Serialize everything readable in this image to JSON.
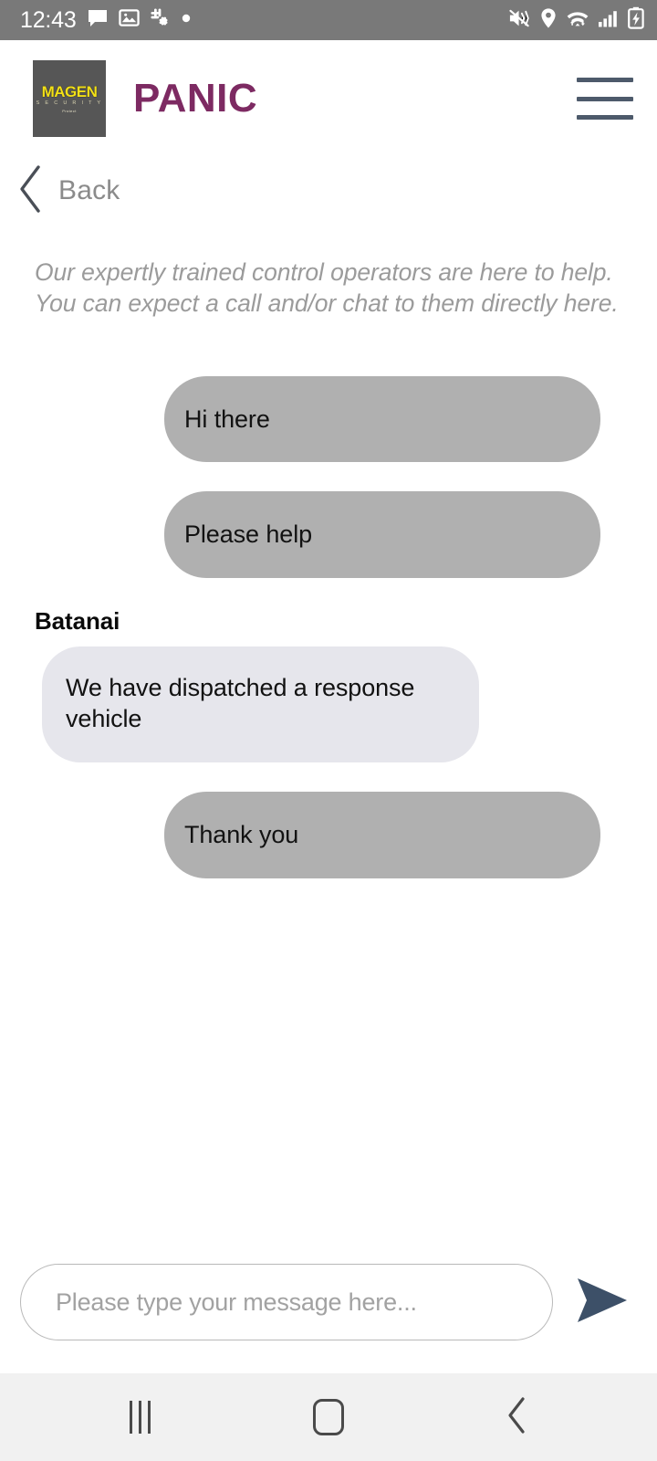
{
  "status_bar": {
    "time": "12:43",
    "left_icons": [
      "message-icon",
      "photo-icon",
      "slack-icon",
      "dot-icon"
    ],
    "right_icons": [
      "mute-vibrate-icon",
      "location-icon",
      "wifi-icon",
      "signal-icon",
      "battery-charging-icon"
    ],
    "background": "#797979"
  },
  "header": {
    "logo": {
      "name": "MAGEN",
      "subtitle": "S E C U R I T Y",
      "tagline": "Protect",
      "background": "#565656",
      "text_color": "#f2e017"
    },
    "title": "PANIC",
    "title_color": "#7d2a62",
    "menu_icon": "hamburger-icon"
  },
  "nav": {
    "back_label": "Back",
    "back_icon": "chevron-left-icon"
  },
  "intro": {
    "line1": "Our expertly trained control operators are here to help.",
    "line2": "You can expect a call and/or chat to them directly here."
  },
  "chat": {
    "messages": [
      {
        "direction": "out",
        "text": "Hi there",
        "sender": ""
      },
      {
        "direction": "out",
        "text": "Please help",
        "sender": ""
      },
      {
        "direction": "in",
        "text": "We have dispatched a response vehicle",
        "sender": "Batanai"
      },
      {
        "direction": "out",
        "text": "Thank you",
        "sender": ""
      }
    ],
    "outgoing_bubble_color": "#b0b0b0",
    "incoming_bubble_color": "#e6e6ec"
  },
  "composer": {
    "placeholder": "Please type your message here...",
    "value": "",
    "send_icon": "send-arrow-icon",
    "send_color": "#3d5068"
  },
  "system_nav": {
    "recents_icon": "recents-icon",
    "home_icon": "home-icon",
    "back_icon": "chevron-left-icon",
    "background": "#f1f1f1"
  }
}
